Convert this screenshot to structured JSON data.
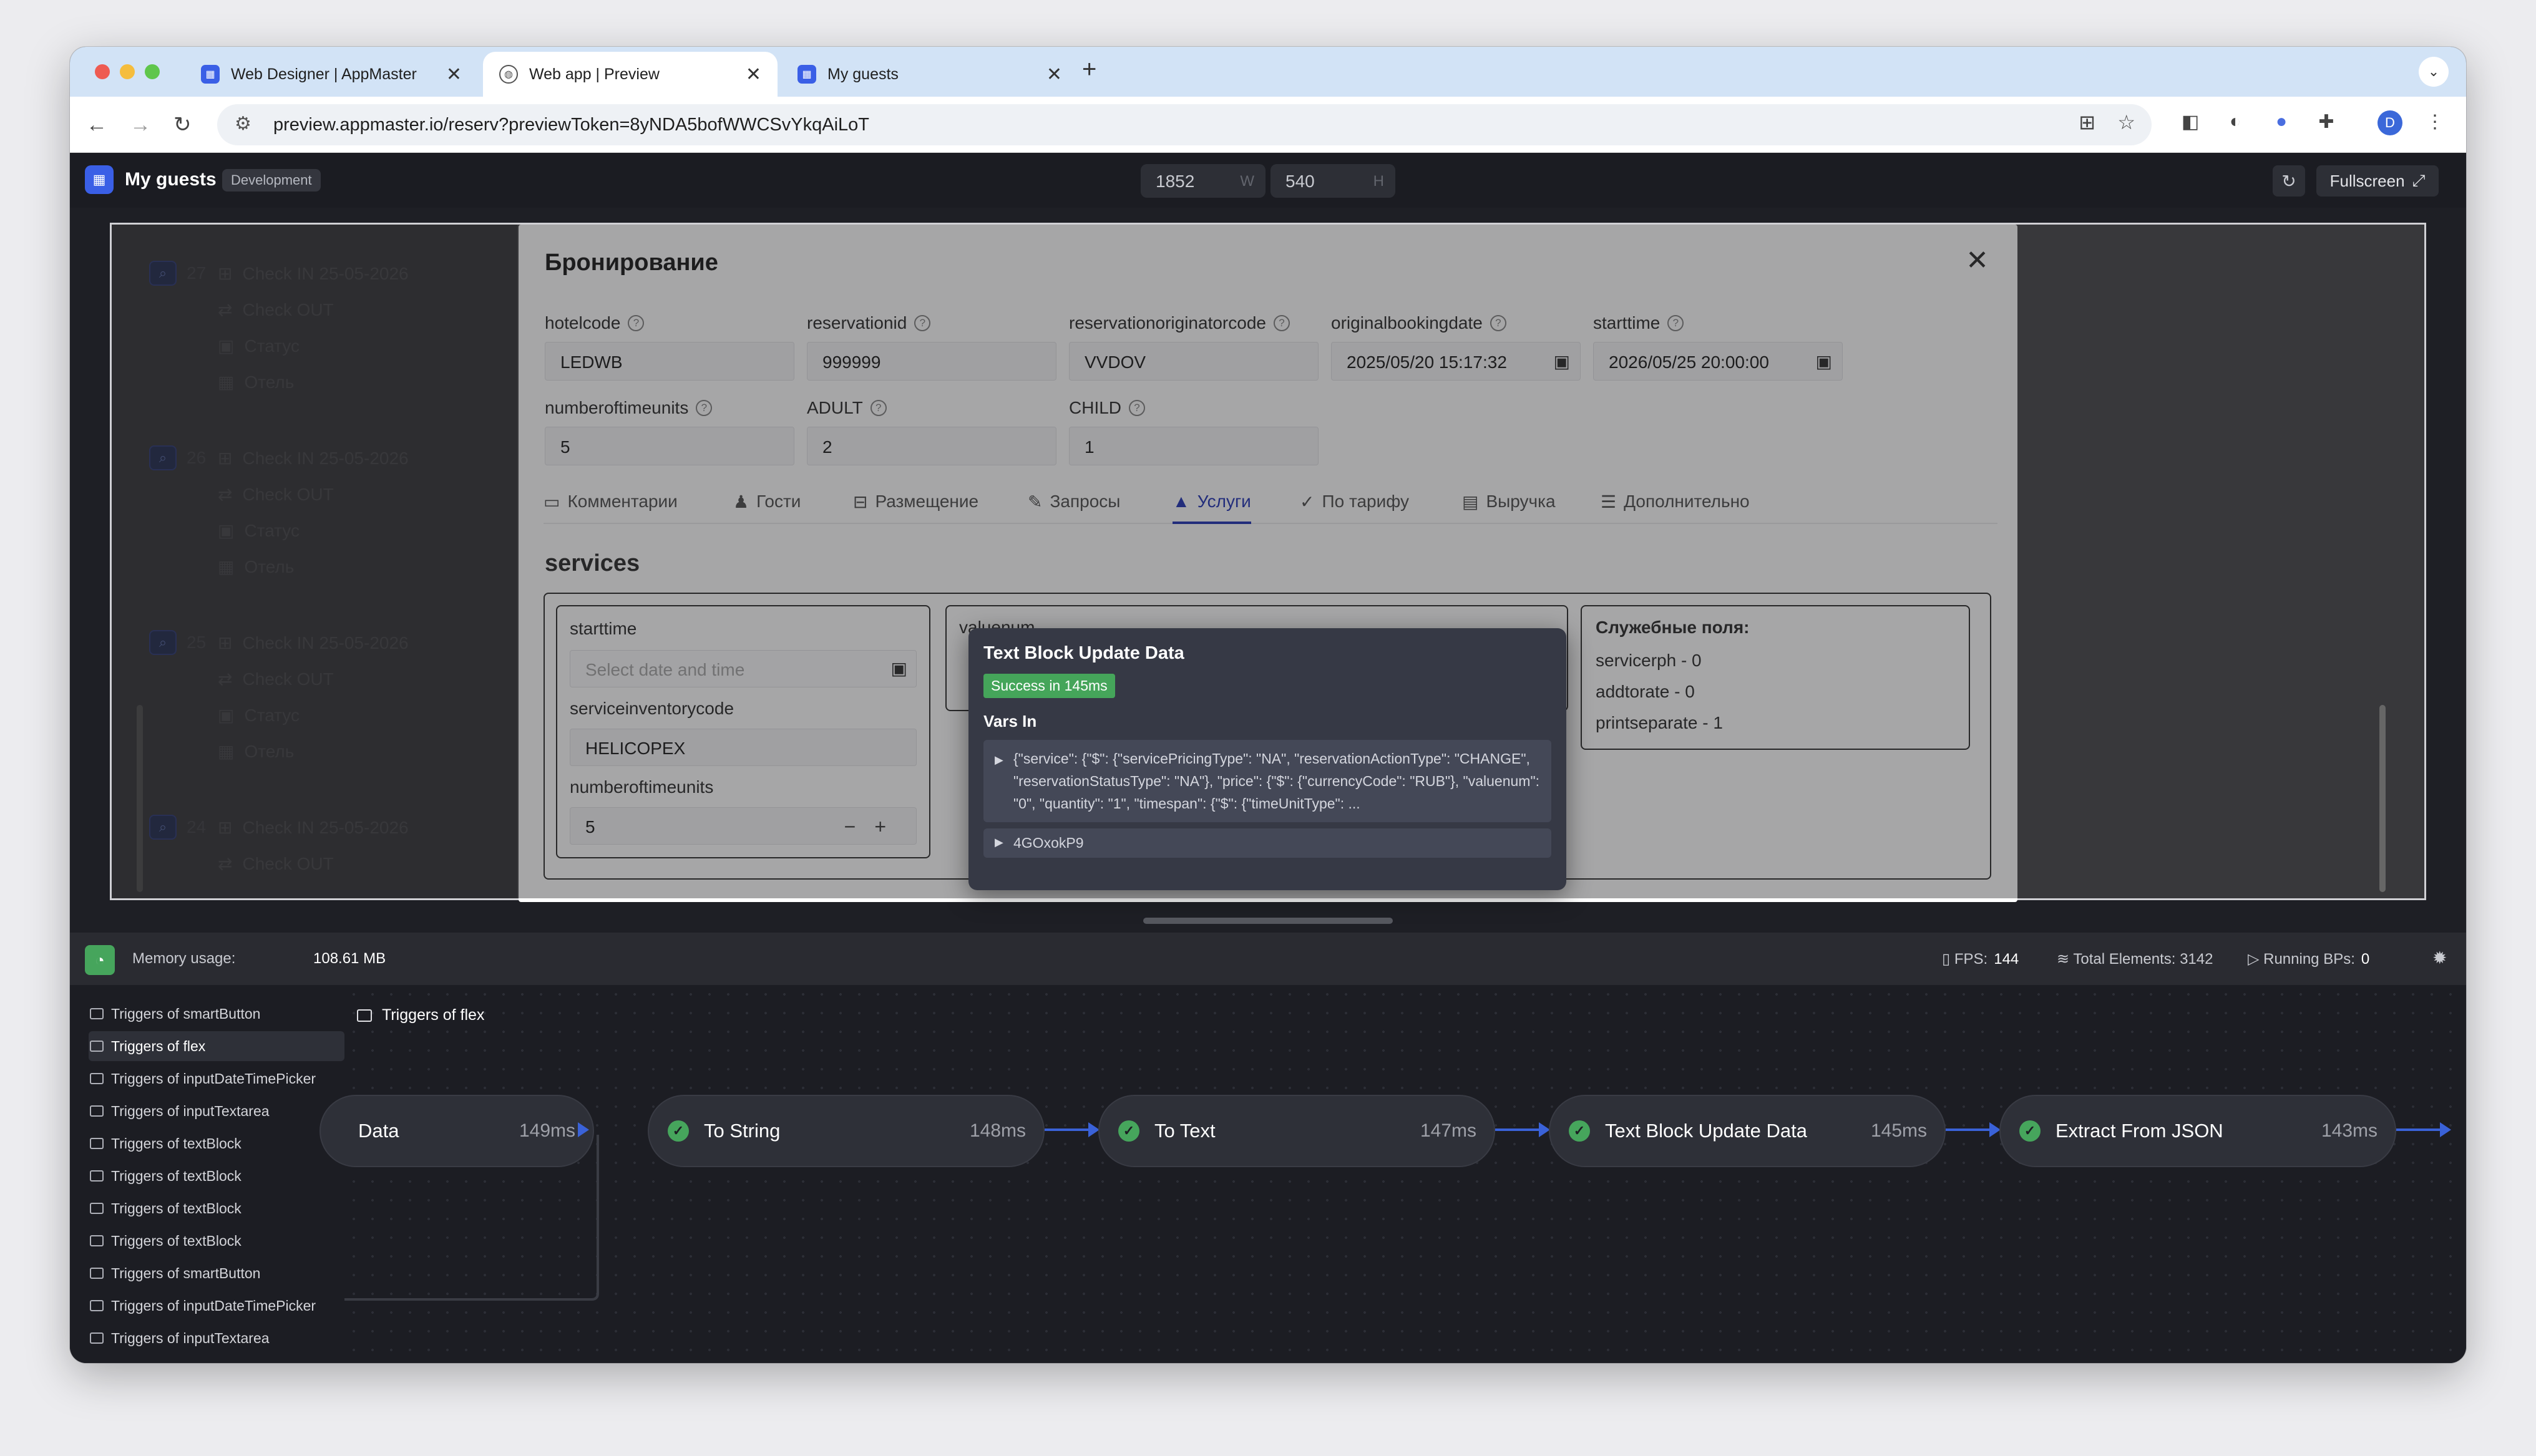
{
  "browser": {
    "tabs": [
      {
        "title": "Web Designer | AppMaster",
        "active": false
      },
      {
        "title": "Web app | Preview",
        "active": true
      },
      {
        "title": "My guests",
        "active": false
      }
    ],
    "url": "preview.appmaster.io/reserv?previewToken=8yNDA5bofWWCSvYkqAiLoT",
    "profile_initial": "D"
  },
  "app": {
    "title": "My guests",
    "env": "Development",
    "width": "1852",
    "height": "540",
    "width_unit": "W",
    "height_unit": "H",
    "fullscreen_label": "Fullscreen"
  },
  "background_list": [
    {
      "num": "",
      "count": "27",
      "lines": [
        "Check IN 25-05-2026",
        "Check OUT",
        "Статус",
        "Отель"
      ]
    },
    {
      "num": "",
      "count": "26",
      "lines": [
        "Check IN 25-05-2026",
        "Check OUT",
        "Статус",
        "Отель"
      ]
    },
    {
      "num": "",
      "count": "25",
      "lines": [
        "Check IN 25-05-2026",
        "Check OUT",
        "Статус",
        "Отель"
      ]
    },
    {
      "num": "",
      "count": "24",
      "lines": [
        "Check IN 25-05-2026",
        "Check OUT"
      ]
    }
  ],
  "modal": {
    "title": "Бронирование",
    "fields": [
      {
        "label": "hotelcode",
        "value": "LEDWB"
      },
      {
        "label": "reservationid",
        "value": "999999"
      },
      {
        "label": "reservationoriginatorcode",
        "value": "VVDOV"
      },
      {
        "label": "originalbookingdate",
        "value": "2025/05/20 15:17:32"
      },
      {
        "label": "starttime",
        "value": "2026/05/25 20:00:00"
      },
      {
        "label": "numberoftimeunits",
        "value": "5"
      },
      {
        "label": "ADULT",
        "value": "2"
      },
      {
        "label": "CHILD",
        "value": "1"
      }
    ],
    "tabs": [
      {
        "label": "Комментарии",
        "icon": "comment-icon"
      },
      {
        "label": "Гости",
        "icon": "person-icon"
      },
      {
        "label": "Размещение",
        "icon": "bed-icon"
      },
      {
        "label": "Запросы",
        "icon": "pencil-icon"
      },
      {
        "label": "Услуги",
        "icon": "service-icon"
      },
      {
        "label": "По тарифу",
        "icon": "check-icon"
      },
      {
        "label": "Выручка",
        "icon": "money-icon"
      },
      {
        "label": "Дополнительно",
        "icon": "settings-icon"
      }
    ],
    "active_tab": "Услуги",
    "section_title": "services",
    "service": {
      "starttime_label": "starttime",
      "starttime_placeholder": "Select date and time",
      "inventory_label": "serviceinventorycode",
      "inventory_value": "HELICOPEX",
      "units_label": "numberoftimeunits",
      "units_value": "5",
      "valuenum_label": "valuenum"
    },
    "system_fields": {
      "title": "Служебные поля:",
      "items": [
        "servicerph - 0",
        "addtorate - 0",
        "printseparate - 1"
      ]
    }
  },
  "popup": {
    "title": "Text Block Update Data",
    "badge": "Success in 145ms",
    "vars_label": "Vars In",
    "vars_json": "{\"service\": {\"$\": {\"servicePricingType\": \"NA\", \"reservationActionType\": \"CHANGE\", \"reservationStatusType\": \"NA\"}, \"price\": {\"$\": {\"currencyCode\": \"RUB\"}, \"valuenum\": \"0\", \"quantity\": \"1\", \"timespan\": {\"$\": {\"timeUnitType\": ...",
    "vars_item": "4GOxokP9"
  },
  "status": {
    "memory_label": "Memory usage:",
    "memory_value": "108.61 MB",
    "fps_label": "FPS:",
    "fps_value": "144",
    "elements_label": "Total Elements: 3142",
    "bps_label": "Running BPs:",
    "bps_value": "0"
  },
  "triggers": {
    "items": [
      "Triggers of smartButton",
      "Triggers of flex",
      "Triggers of inputDateTimePicker",
      "Triggers of inputTextarea",
      "Triggers of textBlock",
      "Triggers of textBlock",
      "Triggers of textBlock",
      "Triggers of textBlock",
      "Triggers of smartButton",
      "Triggers of inputDateTimePicker",
      "Triggers of inputTextarea"
    ],
    "selected": "Triggers of flex"
  },
  "flow": {
    "title": "Triggers of flex",
    "nodes": [
      {
        "label": "Data",
        "time": "149ms"
      },
      {
        "label": "To String",
        "time": "148ms"
      },
      {
        "label": "To Text",
        "time": "147ms"
      },
      {
        "label": "Text Block Update Data",
        "time": "145ms"
      },
      {
        "label": "Extract From JSON",
        "time": "143ms"
      }
    ]
  },
  "colors": {
    "accent": "#2b3cb8",
    "success": "#46a55c",
    "connector": "#3a62d8"
  }
}
